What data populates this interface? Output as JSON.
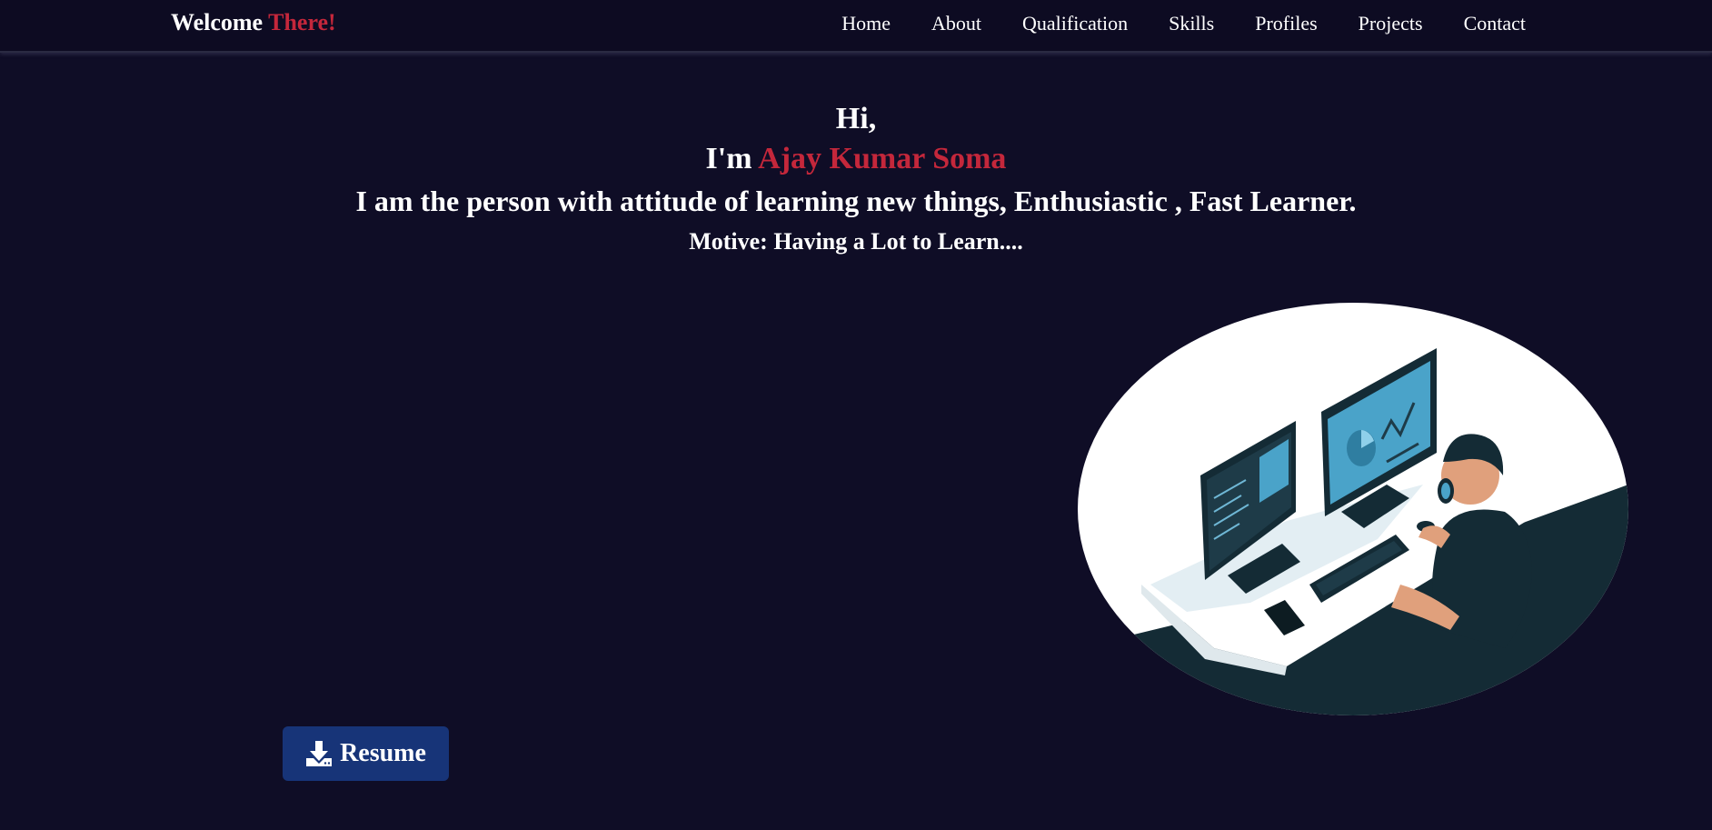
{
  "brand": {
    "first": "Welcome",
    "accent": "There!"
  },
  "nav": {
    "items": [
      {
        "label": "Home"
      },
      {
        "label": "About"
      },
      {
        "label": "Qualification"
      },
      {
        "label": "Skills"
      },
      {
        "label": "Profiles"
      },
      {
        "label": "Projects"
      },
      {
        "label": "Contact"
      }
    ]
  },
  "hero": {
    "greeting": "Hi,",
    "im_prefix": "I'm",
    "name": "Ajay Kumar Soma",
    "description": "I am the person with attitude of learning new things, Enthusiastic , Fast Learner.",
    "motive": "Motive: Having a Lot to Learn...."
  },
  "resume_button": {
    "label": "Resume",
    "icon": "download-icon"
  },
  "illustration": {
    "icon": "developer-at-desk-illustration"
  },
  "colors": {
    "background": "#0f0d26",
    "accent": "#c4273b",
    "button": "#173478"
  }
}
